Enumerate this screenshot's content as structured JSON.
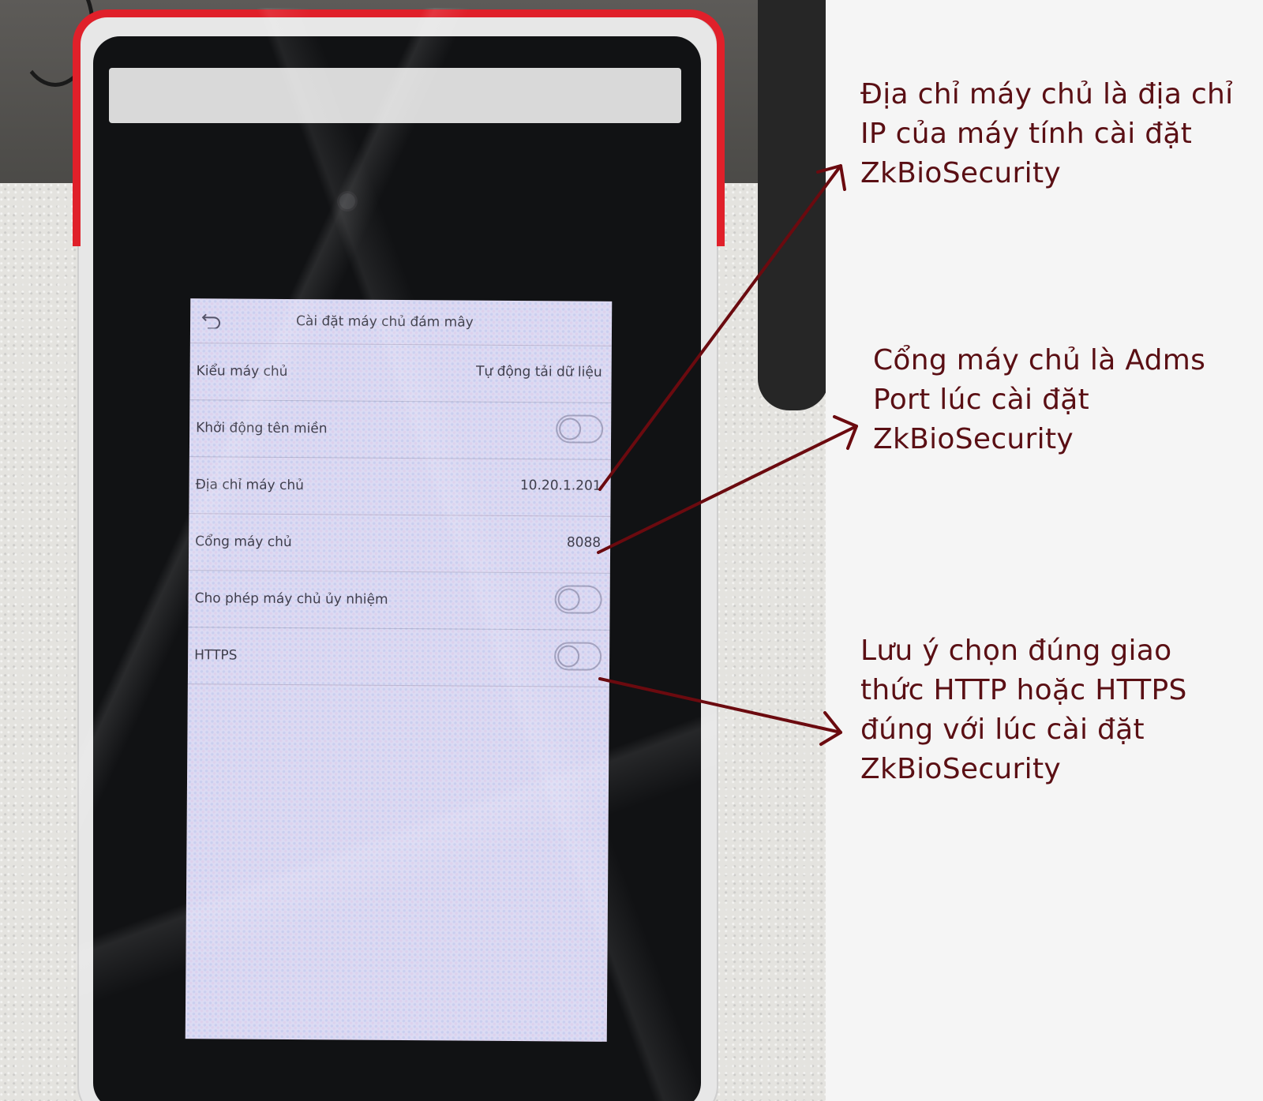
{
  "screen": {
    "title": "Cài đặt máy chủ đám mây",
    "rows": [
      {
        "label": "Kiểu máy chủ",
        "value": "Tự động tải dữ liệu"
      },
      {
        "label": "Khởi động tên miền",
        "toggle_on": false
      },
      {
        "label": "Địa chỉ máy chủ",
        "value": "10.20.1.201"
      },
      {
        "label": "Cổng máy chủ",
        "value": "8088"
      },
      {
        "label": "Cho phép máy chủ ủy nhiệm",
        "toggle_on": false
      },
      {
        "label": "HTTPS",
        "toggle_on": false
      }
    ]
  },
  "annotations": {
    "server_address": [
      "Địa chỉ máy chủ là địa chỉ",
      "IP của máy tính cài đặt",
      "ZkBioSecurity"
    ],
    "server_port": [
      "Cổng máy chủ là Adms",
      "Port lúc cài đặt",
      "ZkBioSecurity"
    ],
    "protocol": [
      "Lưu ý chọn đúng giao",
      "thức HTTP hoặc HTTPS",
      "đúng với lúc cài đặt",
      "ZkBioSecurity"
    ]
  },
  "colors": {
    "annotation_text": "#5a0f14",
    "arrow": "#6b0a0f",
    "tape": "#e0202a",
    "screen_bg": "#dcdbf3"
  }
}
